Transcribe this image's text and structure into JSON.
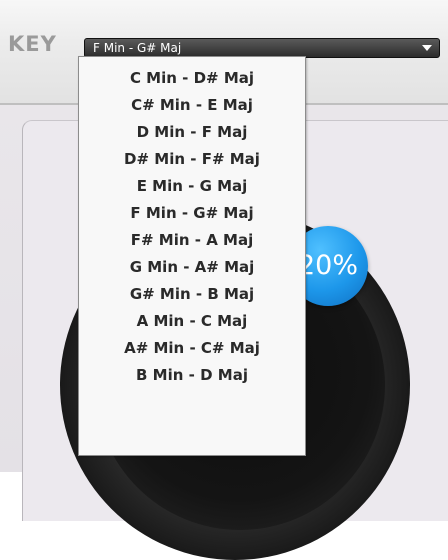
{
  "header": {
    "key_label": "KEY",
    "selected_key": "F Min - G# Maj"
  },
  "dropdown": {
    "options": [
      "C Min - D# Maj",
      "C# Min - E Maj",
      "D Min - F Maj",
      "D# Min - F# Maj",
      "E Min - G Maj",
      "F Min - G# Maj",
      "F# Min - A Maj",
      "G Min - A# Maj",
      "G# Min - B Maj",
      "A Min - C Maj",
      "A# Min - C# Maj",
      "B Min - D Maj"
    ]
  },
  "knob": {
    "value_label": "20%",
    "value": 0.2
  },
  "colors": {
    "badge_blue": "#1d97ea",
    "select_bg": "#3a3a3a",
    "label_gray": "#9a9a9a"
  },
  "icons": {
    "select_arrow": "chevron-down-icon"
  }
}
